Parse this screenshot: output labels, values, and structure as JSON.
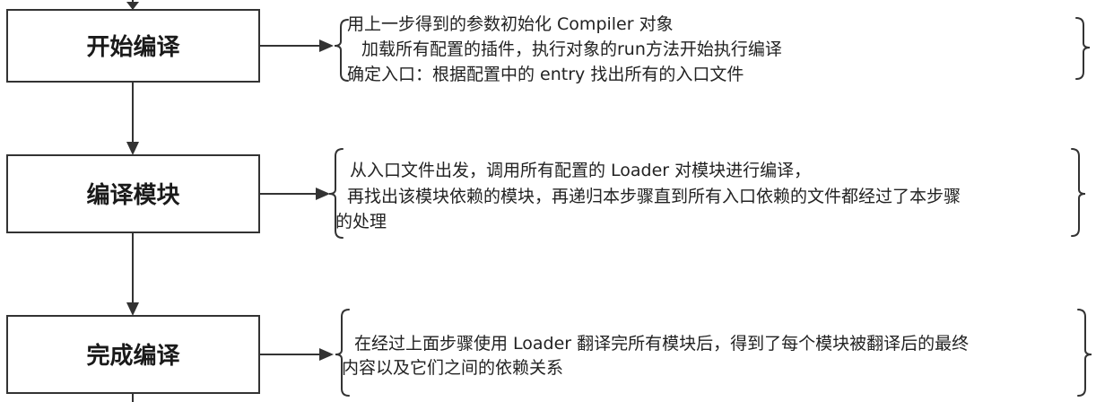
{
  "steps": [
    {
      "label": "开始编译",
      "lines": [
        "用上一步得到的参数初始化 Compiler 对象",
        "加载所有配置的插件，执行对象的run方法开始执行编译",
        "确定入口：根据配置中的 entry 找出所有的入口文件"
      ]
    },
    {
      "label": "编译模块",
      "lines": [
        "从入口文件出发，调用所有配置的 Loader 对模块进行编译，",
        "再找出该模块依赖的模块，再递归本步骤直到所有入口依赖的文件都经过了本步骤",
        "的处理"
      ]
    },
    {
      "label": "完成编译",
      "lines": [
        "在经过上面步骤使用 Loader 翻译完所有模块后，得到了每个模块被翻译后的最终",
        "内容以及它们之间的依赖关系"
      ]
    }
  ]
}
